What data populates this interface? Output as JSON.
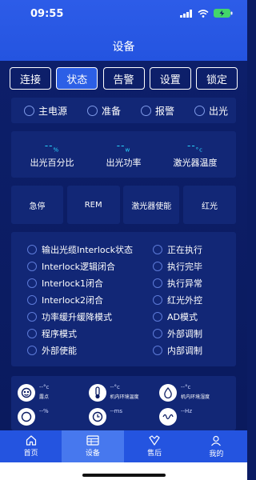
{
  "statusbar": {
    "time": "09:55"
  },
  "header": {
    "title": "设备"
  },
  "tabs": [
    {
      "label": "连接",
      "active": false
    },
    {
      "label": "状态",
      "active": true
    },
    {
      "label": "告警",
      "active": false
    },
    {
      "label": "设置",
      "active": false
    },
    {
      "label": "锁定",
      "active": false
    }
  ],
  "status_indicators": [
    {
      "label": "主电源"
    },
    {
      "label": "准备"
    },
    {
      "label": "报警"
    },
    {
      "label": "出光"
    }
  ],
  "metrics": [
    {
      "value": "--",
      "unit": "%",
      "label": "出光百分比"
    },
    {
      "value": "--",
      "unit": "w",
      "label": "出光功率"
    },
    {
      "value": "--",
      "unit": "°c",
      "label": "激光器温度"
    }
  ],
  "controls": [
    {
      "label": "急停"
    },
    {
      "label": "REM"
    },
    {
      "label": "激光器使能"
    },
    {
      "label": "红光"
    }
  ],
  "status_list_left": [
    {
      "label": "输出光缆Interlock状态"
    },
    {
      "label": "Interlock逻辑闭合"
    },
    {
      "label": "Interlock1闭合"
    },
    {
      "label": "Interlock2闭合"
    },
    {
      "label": "功率缓升缓降模式"
    },
    {
      "label": "程序模式"
    },
    {
      "label": "外部使能"
    }
  ],
  "status_list_right": [
    {
      "label": "正在执行"
    },
    {
      "label": "执行完毕"
    },
    {
      "label": "执行异常"
    },
    {
      "label": "红光外控"
    },
    {
      "label": "AD模式"
    },
    {
      "label": "外部调制"
    },
    {
      "label": "内部调制"
    }
  ],
  "environment": [
    {
      "value": "--°c",
      "label": "露点",
      "icon": "dew-point-icon"
    },
    {
      "value": "--°c",
      "label": "机内环境温度",
      "icon": "thermometer-icon"
    },
    {
      "value": "--°c",
      "label": "机内环境湿度",
      "icon": "humidity-icon"
    },
    {
      "value": "--%",
      "label": "",
      "icon": "gauge-icon"
    },
    {
      "value": "--ms",
      "label": "",
      "icon": "timer-icon"
    },
    {
      "value": "--Hz",
      "label": "",
      "icon": "frequency-icon"
    }
  ],
  "bottom_nav": [
    {
      "label": "首页",
      "icon": "home-icon",
      "active": false
    },
    {
      "label": "设备",
      "icon": "device-icon",
      "active": true
    },
    {
      "label": "售后",
      "icon": "after-sales-icon",
      "active": false
    },
    {
      "label": "我的",
      "icon": "profile-icon",
      "active": false
    }
  ],
  "colors": {
    "header": "#2454e0",
    "background": "#0b1c63",
    "panel": "#122776",
    "accent_value": "#29d8ff"
  }
}
